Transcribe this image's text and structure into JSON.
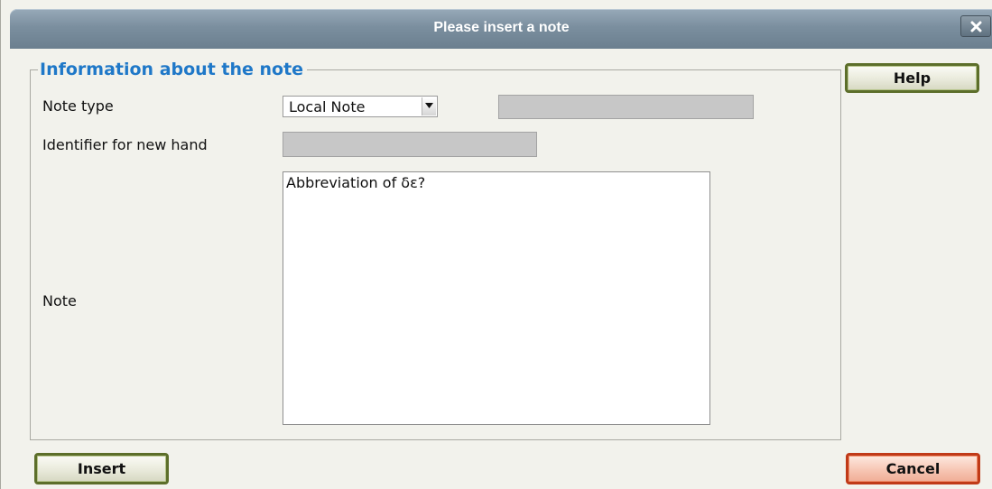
{
  "dialog": {
    "title": "Please insert a note",
    "close_icon": "close-icon"
  },
  "fieldset": {
    "legend": "Information about the note"
  },
  "form": {
    "note_type_label": "Note type",
    "note_type_selected": "Local Note",
    "note_type_extra_value": "",
    "identifier_label": "Identifier for new hand",
    "identifier_value": "",
    "note_label": "Note",
    "note_value": "Abbreviation of δε?"
  },
  "buttons": {
    "help": "Help",
    "insert": "Insert",
    "cancel": "Cancel"
  },
  "colors": {
    "legend": "#1f78c8",
    "titlebar": "#7b8f9f",
    "insert_border": "#5c6e2a",
    "help_border": "#5c6e2a",
    "cancel_border": "#c03a18",
    "disabled_field": "#c7c7c7"
  }
}
